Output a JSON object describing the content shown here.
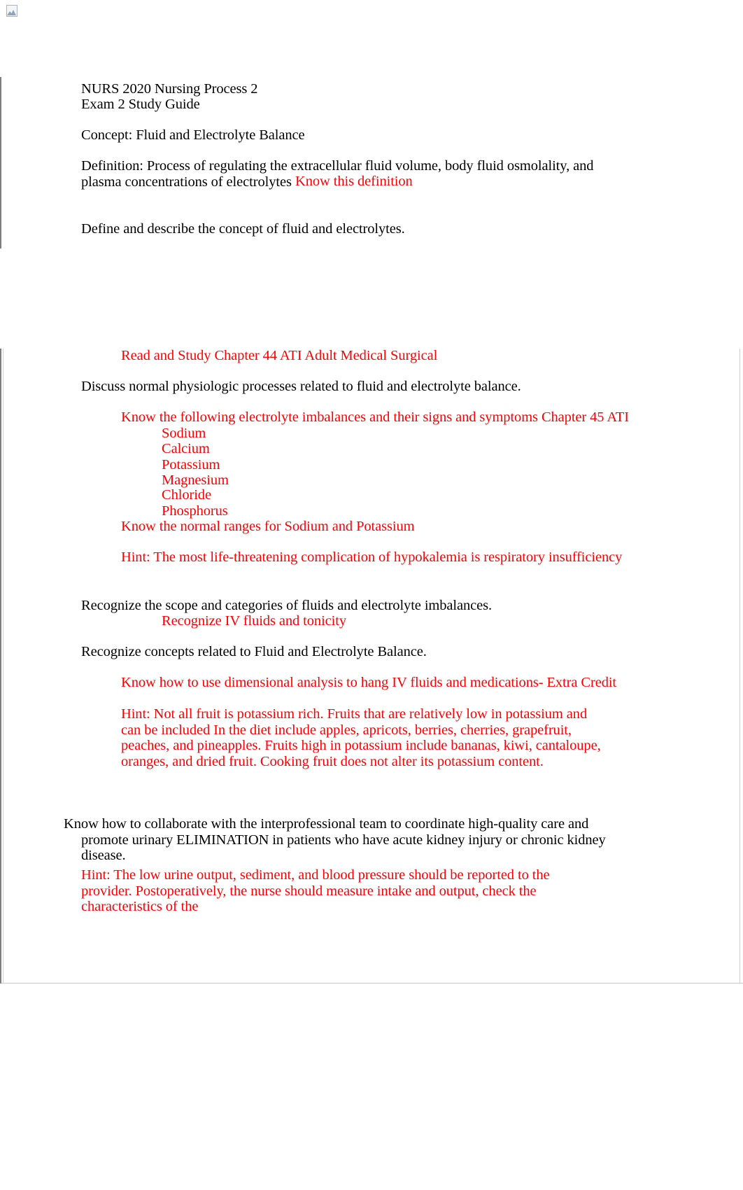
{
  "document": {
    "page_background": "#ffffff",
    "body_text_color": "#000000",
    "annotation_color": "#ff0000",
    "broken_image_alt": "broken-image-placeholder"
  },
  "header": {
    "course_line": "NURS 2020 Nursing Process 2",
    "exam_line": "Exam 2 Study Guide"
  },
  "concept": {
    "concept_line": "Concept: Fluid and Electrolyte Balance",
    "definition_text": "Definition: Process of regulating the extracellular fluid volume, body fluid osmolality, and\nplasma concentrations of electrolytes",
    "definition_note": "Know this definition"
  },
  "objectives": {
    "define_describe": "Define and describe the concept of fluid and electrolytes.",
    "read_study_note": "Read and Study Chapter 44 ATI Adult Medical Surgical",
    "discuss_processes": "Discuss normal physiologic processes related to fluid and electrolyte balance.",
    "electrolyte_note": "Know the following electrolyte imbalances and their signs and symptoms Chapter 45 ATI",
    "electrolytes": [
      "Sodium",
      "Calcium",
      "Potassium",
      "Magnesium",
      "Chloride",
      "Phosphorus"
    ],
    "normal_ranges_note": "Know the normal ranges for Sodium and Potassium",
    "hint_hypokalemia": "Hint: The most life-threatening complication of hypokalemia is respiratory insufficiency",
    "recognize_scope": "Recognize the scope and categories of fluids and electrolyte imbalances.",
    "recognize_iv_note": "Recognize IV fluids and tonicity",
    "recognize_concepts": "Recognize concepts related to Fluid and Electrolyte Balance.",
    "dimensional_analysis_note": "Know how to use dimensional analysis to hang IV fluids and medications- Extra Credit",
    "hint_potassium_fruit": "Hint: Not all fruit is potassium rich. Fruits that are relatively low in potassium and can be included In the diet include apples, apricots, berries, cherries, grapefruit, peaches, and pineapples. Fruits high in potassium include bananas, kiwi, cantaloupe, oranges, and dried fruit. Cooking fruit does not alter its potassium content.",
    "collaborate_text": "Know how to collaborate with the interprofessional team to coordinate high-quality care and promote urinary ELIMINATION in patients who have acute kidney injury or chronic kidney disease.",
    "hint_urine_output": "Hint: The low urine output, sediment, and blood pressure should be reported to the provider. Postoperatively, the nurse should measure intake and output, check the characteristics of the"
  }
}
